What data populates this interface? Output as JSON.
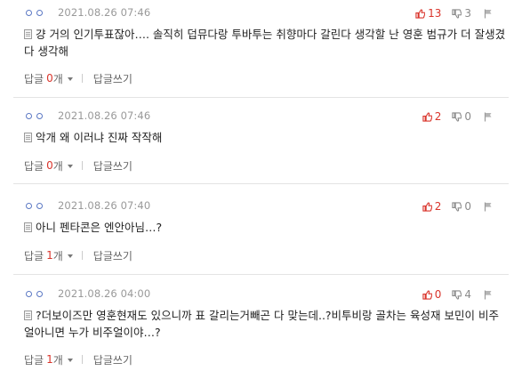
{
  "comments": [
    {
      "date": "2021.08.26 07:46",
      "text": "걍 거의 인기투표잖아…. 솔직히 덥뮤다랑 투바투는 취향마다 갈린다 생각할 난 영훈 범규가 더 잘생겼다 생각해",
      "up": "13",
      "down": "3",
      "reply_label": "답글",
      "reply_count": "0",
      "reply_unit": "개",
      "write_label": "답글쓰기"
    },
    {
      "date": "2021.08.26 07:46",
      "text": "악개 왜 이러냐 진짜 작작해",
      "up": "2",
      "down": "0",
      "reply_label": "답글",
      "reply_count": "0",
      "reply_unit": "개",
      "write_label": "답글쓰기"
    },
    {
      "date": "2021.08.26 07:40",
      "text": "아니 펜타콘은 엔안아님…?",
      "up": "2",
      "down": "0",
      "reply_label": "답글",
      "reply_count": "1",
      "reply_unit": "개",
      "write_label": "답글쓰기"
    },
    {
      "date": "2021.08.26 04:00",
      "text": "?더보이즈만 영훈현재도 있으니까 표 갈리는거빼곤 다 맞는데..?비투비랑 골차는 육성재 보민이 비주얼아니면 누가 비주얼이야…?",
      "up": "0",
      "down": "4",
      "reply_label": "답글",
      "reply_count": "1",
      "reply_unit": "개",
      "write_label": "답글쓰기"
    }
  ],
  "icons": {
    "author": "anonymous-user-icon",
    "body": "document-icon",
    "up": "thumbs-up-icon",
    "down": "thumbs-down-icon",
    "report": "report-icon",
    "toggle": "caret-down-icon"
  },
  "colors": {
    "accent_red": "#d9342b",
    "author_blue": "#5b78c4",
    "meta_gray": "#999999",
    "divider": "#e4e4e4"
  }
}
